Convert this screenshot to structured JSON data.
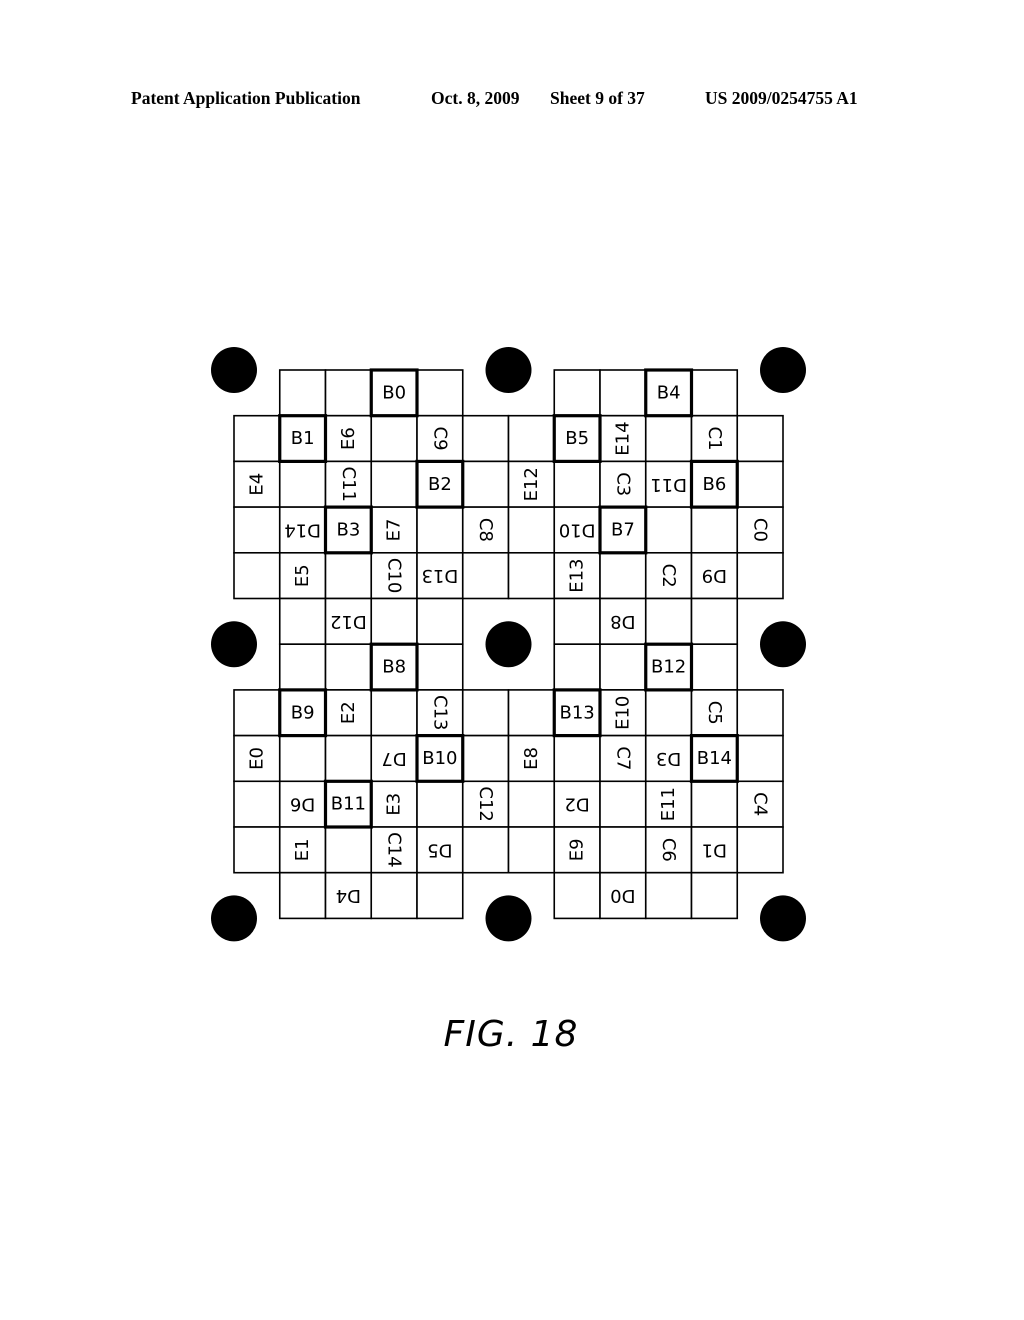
{
  "header": {
    "publication": "Patent Application Publication",
    "date": "Oct. 8, 2009",
    "sheet": "Sheet 9 of 37",
    "number": "US 2009/0254755 A1"
  },
  "figure": {
    "caption": "FIG. 18",
    "orientation_rules": {
      "B": "upright",
      "C": "rotated 90 clockwise",
      "D": "rotated 180",
      "E": "rotated 90 counter-clockwise"
    },
    "grid": {
      "rows": [
        [
          "",
          "",
          "",
          "B0",
          "",
          "",
          "",
          "",
          "",
          "B4",
          "",
          ""
        ],
        [
          "",
          "B1",
          "E6",
          "",
          "C9",
          "",
          "",
          "B5",
          "E14",
          "",
          "C1",
          ""
        ],
        [
          "E4",
          "",
          "C11",
          "",
          "B2",
          "",
          "E12",
          "",
          "C3",
          "D11",
          "B6",
          ""
        ],
        [
          "",
          "D14",
          "B3",
          "E7",
          "",
          "C8",
          "",
          "D10",
          "B7",
          "",
          "",
          "C0"
        ],
        [
          "",
          "E5",
          "",
          "C10",
          "D13",
          "",
          "",
          "E13",
          "",
          "C2",
          "D9",
          ""
        ],
        [
          "",
          "",
          "D12",
          "",
          "",
          "",
          "",
          "",
          "D8",
          "",
          "",
          ""
        ],
        [
          "",
          "",
          "",
          "B8",
          "",
          "",
          "",
          "",
          "",
          "B12",
          "",
          ""
        ],
        [
          "",
          "B9",
          "E2",
          "",
          "C13",
          "",
          "",
          "B13",
          "E10",
          "",
          "C5",
          ""
        ],
        [
          "E0",
          "",
          "",
          "D7",
          "B10",
          "",
          "E8",
          "",
          "C7",
          "D3",
          "B14",
          ""
        ],
        [
          "",
          "D6",
          "B11",
          "E3",
          "",
          "C12",
          "",
          "D2",
          "",
          "E11",
          "",
          "C4"
        ],
        [
          "",
          "E1",
          "",
          "C14",
          "D5",
          "",
          "",
          "E9",
          "",
          "C6",
          "D1",
          ""
        ],
        [
          "",
          "",
          "D4",
          "",
          "",
          "",
          "",
          "",
          "D0",
          "",
          "",
          ""
        ]
      ],
      "narrow_rows": [
        0,
        5,
        6,
        11
      ],
      "narrow_row_columns": [
        1,
        2,
        3,
        4,
        7,
        8,
        9,
        10
      ],
      "full_row_columns": [
        0,
        1,
        2,
        3,
        4,
        5,
        6,
        7,
        8,
        9,
        10,
        11
      ]
    },
    "target_dots": [
      {
        "row_edge": 0,
        "col_edge": 0
      },
      {
        "row_edge": 0,
        "col_edge": 6
      },
      {
        "row_edge": 0,
        "col_edge": 12
      },
      {
        "row_edge": 6,
        "col_edge": 0
      },
      {
        "row_edge": 6,
        "col_edge": 6
      },
      {
        "row_edge": 6,
        "col_edge": 12
      },
      {
        "row_edge": 12,
        "col_edge": 0
      },
      {
        "row_edge": 12,
        "col_edge": 6
      },
      {
        "row_edge": 12,
        "col_edge": 12
      }
    ]
  }
}
